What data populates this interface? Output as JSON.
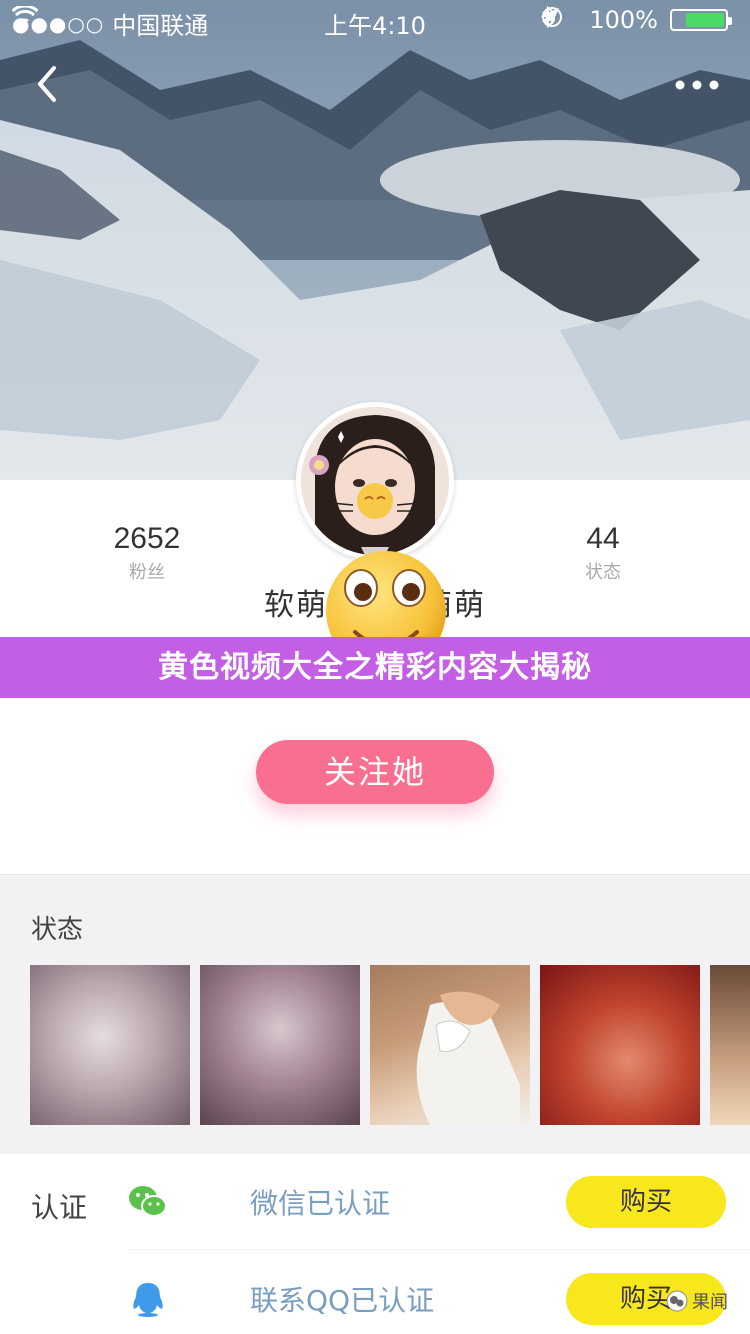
{
  "status_bar": {
    "signal": "●●●○○",
    "carrier": "中国联通",
    "time": "上午4:10",
    "battery_percent": "100%",
    "battery_level": 1.0,
    "icons": [
      "wifi-icon",
      "rotation-lock-icon",
      "location-arrow-icon",
      "bluetooth-icon",
      "battery-icon",
      "charging-bolt-icon"
    ]
  },
  "nav": {
    "back_icon": "chevron-left-icon",
    "more_icon": "more-dots-icon"
  },
  "profile": {
    "fans_count": "2652",
    "fans_label": "粉丝",
    "posts_count": "44",
    "posts_label": "状态",
    "nickname_left": "软萌",
    "nickname_right": "萌萌"
  },
  "banner": {
    "text": "黄色视频大全之精彩内容大揭秘"
  },
  "follow": {
    "label": "关注她"
  },
  "posts": {
    "title": "状态"
  },
  "verification": {
    "label": "认证",
    "items": [
      {
        "icon": "wechat-icon",
        "text": "微信已认证",
        "button": "购买"
      },
      {
        "icon": "qq-icon",
        "text": "联系QQ已认证",
        "button": "购买"
      }
    ]
  },
  "watermark": {
    "text": "果闻"
  },
  "colors": {
    "banner_bg": "#c35fe5",
    "follow_bg": "#f96f90",
    "buy_bg": "#f8e71c",
    "verify_text": "#7a9ec0",
    "section_bg": "#f2f1f4"
  }
}
